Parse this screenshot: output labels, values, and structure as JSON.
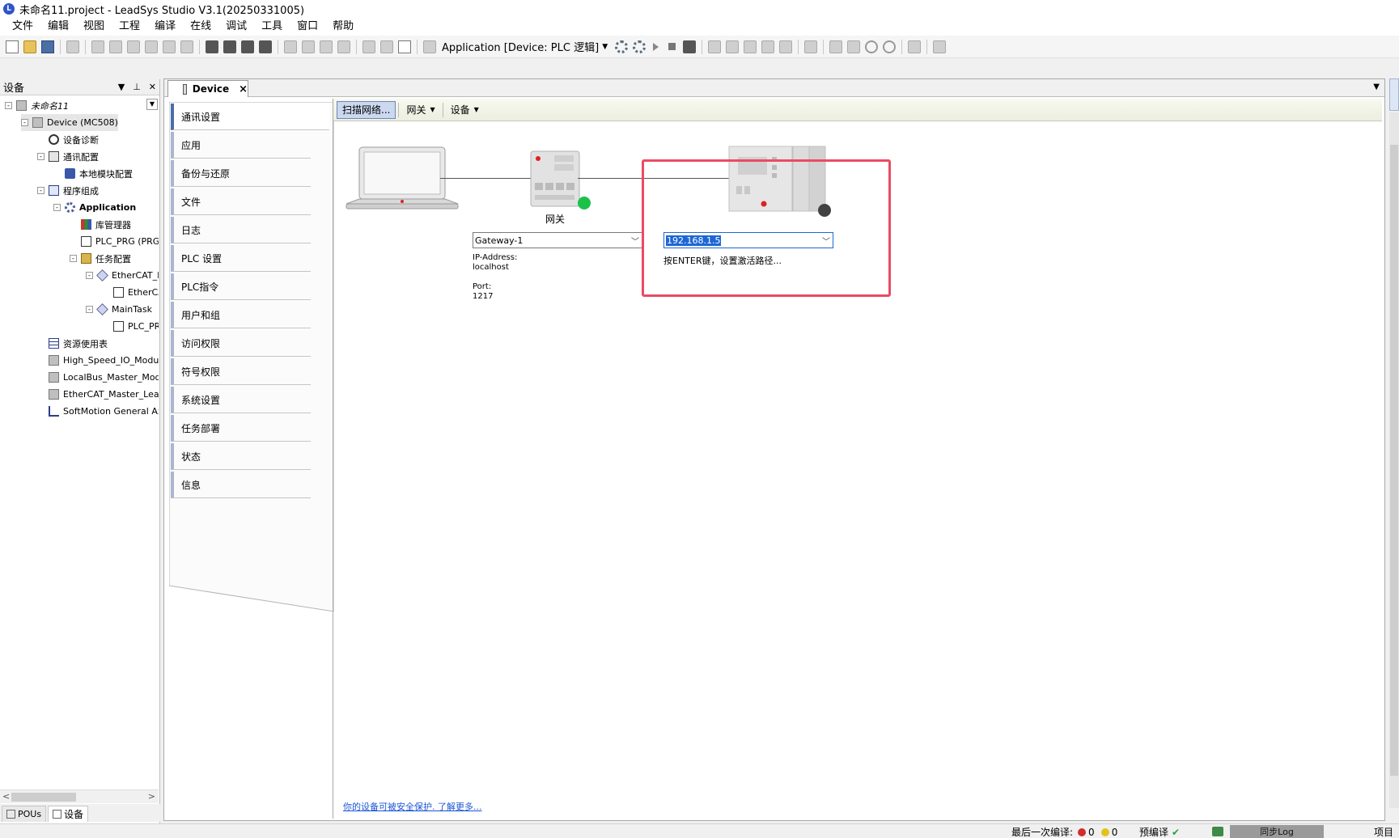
{
  "window": {
    "title": "未命名11.project - LeadSys Studio V3.1(20250331005)"
  },
  "menu": [
    "文件",
    "编辑",
    "视图",
    "工程",
    "编译",
    "在线",
    "调试",
    "工具",
    "窗口",
    "帮助"
  ],
  "toolbar": {
    "app_label": "Application [Device: PLC 逻辑]"
  },
  "device_panel": {
    "title": "设备",
    "tree": [
      {
        "label": "未命名11",
        "depth": 0,
        "expander": "-",
        "icon": "project",
        "style": "italic"
      },
      {
        "label": "Device (MC508)",
        "depth": 1,
        "expander": "-",
        "icon": "device",
        "style": "selected"
      },
      {
        "label": "设备诊断",
        "depth": 2,
        "expander": "",
        "icon": "search",
        "style": ""
      },
      {
        "label": "通讯配置",
        "depth": 2,
        "expander": "-",
        "icon": "network",
        "style": ""
      },
      {
        "label": "本地模块配置",
        "depth": 3,
        "expander": "",
        "icon": "module",
        "style": ""
      },
      {
        "label": "程序组成",
        "depth": 2,
        "expander": "-",
        "icon": "program",
        "style": ""
      },
      {
        "label": "Application",
        "depth": 3,
        "expander": "-",
        "icon": "gear",
        "style": "bold"
      },
      {
        "label": "库管理器",
        "depth": 4,
        "expander": "",
        "icon": "library",
        "style": ""
      },
      {
        "label": "PLC_PRG (PRG)",
        "depth": 4,
        "expander": "",
        "icon": "pou",
        "style": ""
      },
      {
        "label": "任务配置",
        "depth": 4,
        "expander": "-",
        "icon": "task",
        "style": ""
      },
      {
        "label": "EtherCAT_M",
        "depth": 5,
        "expander": "-",
        "icon": "ethercat",
        "style": ""
      },
      {
        "label": "EtherCA",
        "depth": 6,
        "expander": "",
        "icon": "pou",
        "style": ""
      },
      {
        "label": "MainTask",
        "depth": 5,
        "expander": "-",
        "icon": "ethercat",
        "style": ""
      },
      {
        "label": "PLC_PR",
        "depth": 6,
        "expander": "",
        "icon": "pou",
        "style": ""
      },
      {
        "label": "资源使用表",
        "depth": 2,
        "expander": "",
        "icon": "table",
        "style": ""
      },
      {
        "label": "High_Speed_IO_Module",
        "depth": 2,
        "expander": "",
        "icon": "device",
        "style": ""
      },
      {
        "label": "LocalBus_Master_Module",
        "depth": 2,
        "expander": "",
        "icon": "device",
        "style": ""
      },
      {
        "label": "EtherCAT_Master_Leads",
        "depth": 2,
        "expander": "",
        "icon": "device",
        "style": ""
      },
      {
        "label": "SoftMotion General Axis",
        "depth": 2,
        "expander": "",
        "icon": "axis",
        "style": ""
      }
    ],
    "bottom_tabs": [
      "POUs",
      "设备"
    ]
  },
  "editor": {
    "tab_label": "Device",
    "nav": [
      "通讯设置",
      "应用",
      "备份与还原",
      "文件",
      "日志",
      "PLC 设置",
      "PLC指令",
      "用户和组",
      "访问权限",
      "符号权限",
      "系统设置",
      "任务部署",
      "状态",
      "信息"
    ],
    "content_toolbar": {
      "scan": "扫描网络...",
      "gateway": "网关",
      "device": "设备"
    },
    "gateway": {
      "caption": "网关",
      "selected": "Gateway-1",
      "ip_label": "IP-Address:",
      "ip_value": "localhost",
      "port_label": "Port:",
      "port_value": "1217"
    },
    "device_address": {
      "value": "192.168.1.5",
      "hint": "按ENTER键，设置激活路径..."
    },
    "security_link": "你的设备可被安全保护. 了解更多..."
  },
  "statusbar": {
    "last_build": "最后一次编译:",
    "errors": "0",
    "warnings": "0",
    "precompile": "预编译",
    "sync": "同步Log",
    "project_user": "项目"
  },
  "colors": {
    "accent": "#4a6ea8",
    "gateway_ok": "#1cc14a",
    "plc_state": "#424242",
    "highlight_frame": "#ea4b63",
    "link": "#1a55d6"
  }
}
